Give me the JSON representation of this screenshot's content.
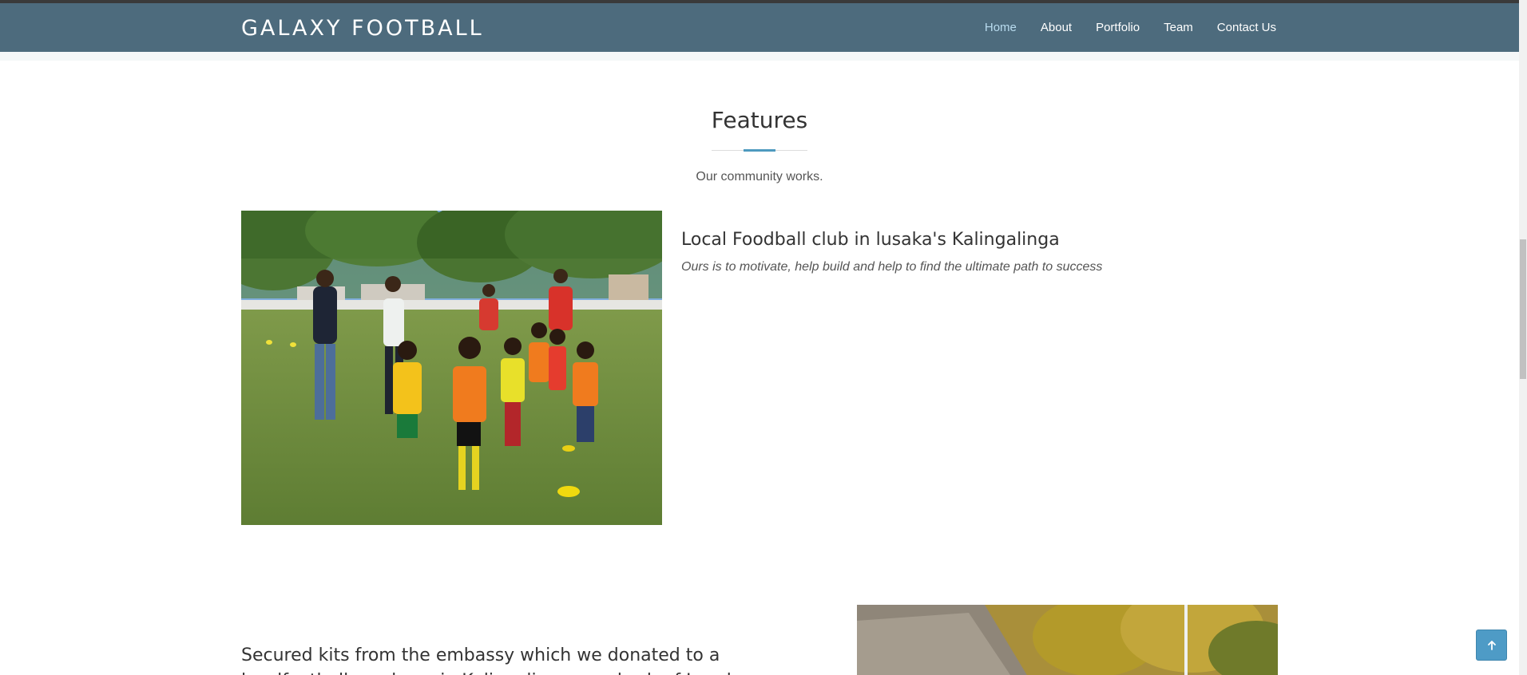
{
  "navbar": {
    "brand": "GALAXY FOOTBALL",
    "links": [
      {
        "label": "Home",
        "active": true
      },
      {
        "label": "About",
        "active": false
      },
      {
        "label": "Portfolio",
        "active": false
      },
      {
        "label": "Team",
        "active": false
      },
      {
        "label": "Contact Us",
        "active": false
      }
    ]
  },
  "features": {
    "title": "Features",
    "subtitle": "Our community works.",
    "items": [
      {
        "title": "Local Foodball club in lusaka's Kalingalinga",
        "text": "Ours is to motivate, help build and help to find the ultimate path to success",
        "image": "photo-coach-with-children"
      },
      {
        "title": "Secured kits from the embassy which we donated to a localfootball academy in Kalingalinga, a suburb of Lusaka",
        "image": "photo-thatched-roof-trees"
      }
    ]
  },
  "back_to_top": {
    "icon": "arrow-up-icon"
  },
  "colors": {
    "navbar": "#4d6b7d",
    "accent": "#4e9abf",
    "active_link": "#b9dcef"
  }
}
